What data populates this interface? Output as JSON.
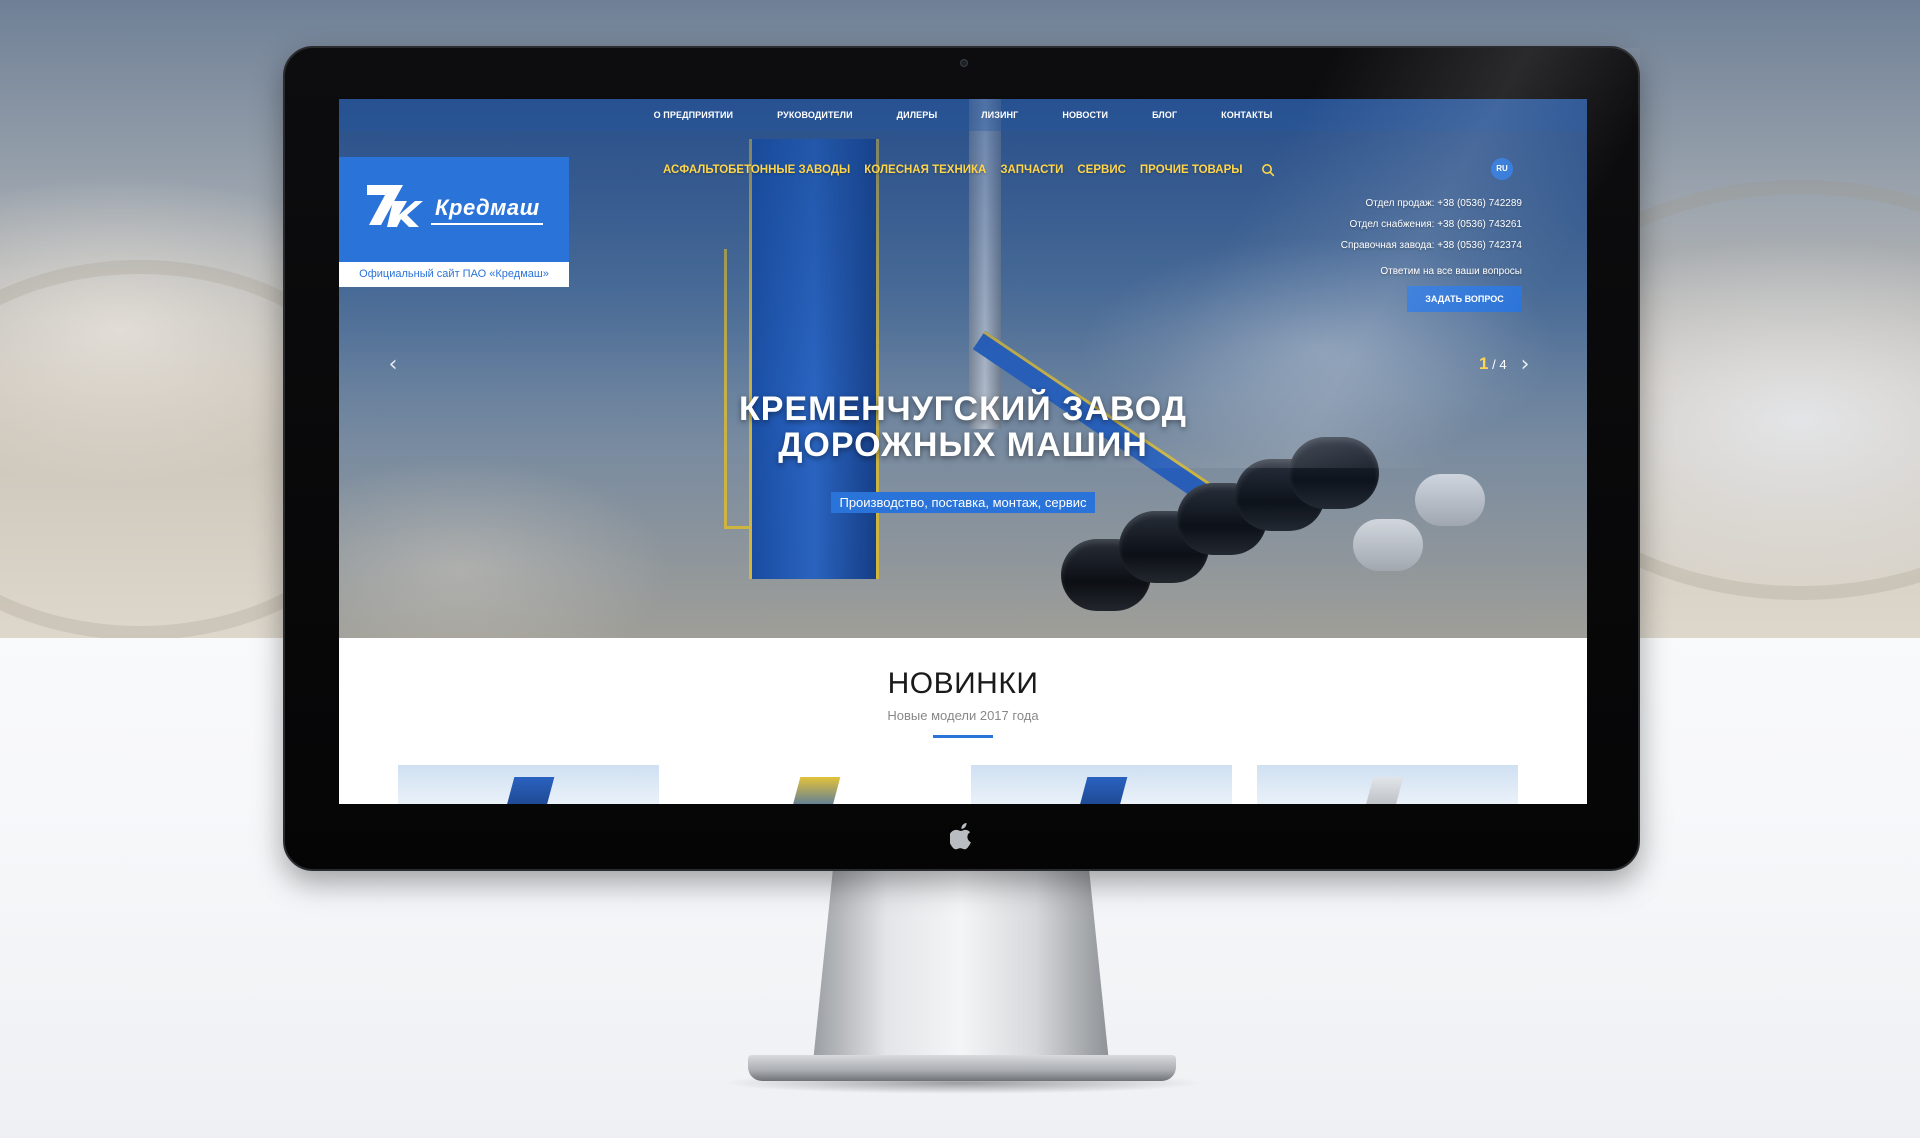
{
  "top_nav": [
    {
      "label": "О ПРЕДПРИЯТИИ"
    },
    {
      "label": "РУКОВОДИТЕЛИ"
    },
    {
      "label": "ДИЛЕРЫ"
    },
    {
      "label": "ЛИЗИНГ"
    },
    {
      "label": "НОВОСТИ"
    },
    {
      "label": "БЛОГ"
    },
    {
      "label": "КОНТАКТЫ"
    }
  ],
  "logo": {
    "text": "Кредмаш",
    "caption": "Официальный сайт ПАО «Кредмаш»"
  },
  "main_nav": [
    {
      "label": "АСФАЛЬТОБЕТОННЫЕ ЗАВОДЫ"
    },
    {
      "label": "КОЛЕСНАЯ ТЕХНИКА"
    },
    {
      "label": "ЗАПЧАСТИ"
    },
    {
      "label": "СЕРВИС"
    },
    {
      "label": "ПРОЧИЕ ТОВАРЫ"
    }
  ],
  "icons": {
    "search": "search-icon",
    "prev": "chevron-left-icon",
    "next": "chevron-right-icon",
    "apple": "apple-logo-icon"
  },
  "language": "RU",
  "contacts": [
    {
      "text": "Отдел продаж: +38 (0536) 742289"
    },
    {
      "text": "Отдел снабжения: +38 (0536) 743261"
    },
    {
      "text": "Справочная завода: +38 (0536) 742374"
    }
  ],
  "answer_text": "Ответим на все ваши вопросы",
  "ask_button": "ЗАДАТЬ ВОПРОС",
  "slider": {
    "prev_symbol": "‹",
    "next_symbol": "›",
    "current": "1",
    "separator_total": "/ 4"
  },
  "hero": {
    "title_line1": "КРЕМЕНЧУГСКИЙ ЗАВОД",
    "title_line2": "ДОРОЖНЫХ МАШИН",
    "subtitle": "Производство, поставка, монтаж, сервис"
  },
  "news": {
    "title": "НОВИНКИ",
    "subtitle": "Новые модели 2017 года"
  },
  "colors": {
    "accent": "#2a73d8",
    "nav_highlight": "#ffd54a",
    "bezel": "#0d0d0f"
  }
}
